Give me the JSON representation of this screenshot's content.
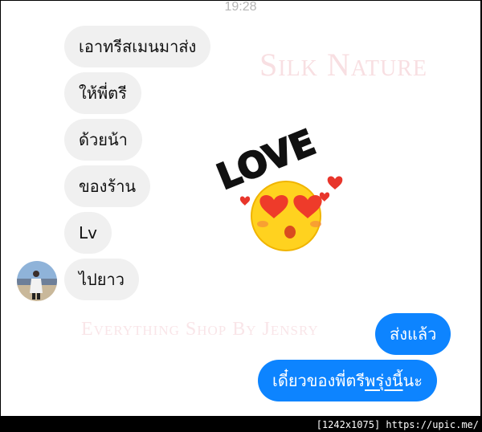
{
  "status_bar": {
    "time": "19:28"
  },
  "watermarks": {
    "top": "Silk Nature",
    "bottom": "Everything Shop By Jensry"
  },
  "incoming_messages": [
    "เอาทรีสเมนมาส่ง",
    "ให้พี่ตรี",
    "ด้วยน้า",
    "ของร้าน",
    "Lv",
    "ไปยาว"
  ],
  "sticker": {
    "icon": "love-heart-eyes-emoji-sticker",
    "text": "LOVE"
  },
  "outgoing_messages": {
    "first": "ส่งแล้ว",
    "second_before": "เดี๋ยวของพี่ตรี",
    "second_underlined": "พรุ่งนี้",
    "second_after": "นะ"
  },
  "contact": {
    "avatar_icon": "contact-avatar"
  },
  "credit": "[1242x1075] https://upic.me/",
  "colors": {
    "outgoing_bubble": "#0d84ff",
    "incoming_bubble": "#f0f0f0"
  }
}
